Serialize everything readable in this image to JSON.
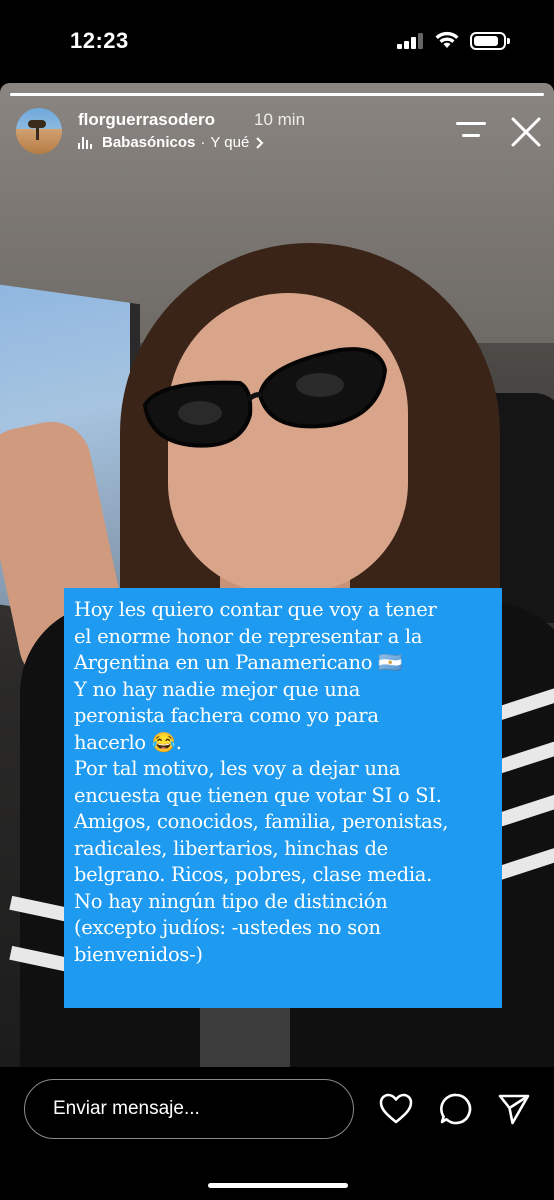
{
  "status_bar": {
    "time": "12:23",
    "signal_icon": "cellular-signal-icon",
    "wifi_icon": "wifi-icon",
    "battery_icon": "battery-icon",
    "battery_level": 0.85
  },
  "story": {
    "progress": 1.0,
    "username": "florguerrasodero",
    "time_ago": "10 min",
    "music": {
      "icon": "music-bars-icon",
      "title": "Babasónicos",
      "separator": "·",
      "artist": "Y qué"
    },
    "menu_icon": "menu-icon",
    "close_icon": "close-icon",
    "overlay_lines": [
      "Hoy les quiero contar que voy a tener",
      "el enorme honor de representar a la",
      "Argentina en un Panamericano 🇦🇷",
      "Y no hay nadie mejor que una",
      "peronista fachera como yo para",
      "hacerlo 😂.",
      "Por tal motivo, les voy a dejar una",
      "encuesta que tienen que votar SI o SI.",
      "Amigos, conocidos, familia, peronistas,",
      "radicales, libertarios, hinchas de",
      "belgrano. Ricos, pobres, clase media.",
      "No hay ningún tipo de distinción",
      "(excepto judíos: -ustedes no son",
      "bienvenidos-)"
    ],
    "overlay_color": "#1E9BF0"
  },
  "reply_bar": {
    "placeholder": "Enviar mensaje...",
    "like_icon": "heart-icon",
    "reply_icon": "chat-bubble-icon",
    "share_icon": "send-icon"
  }
}
